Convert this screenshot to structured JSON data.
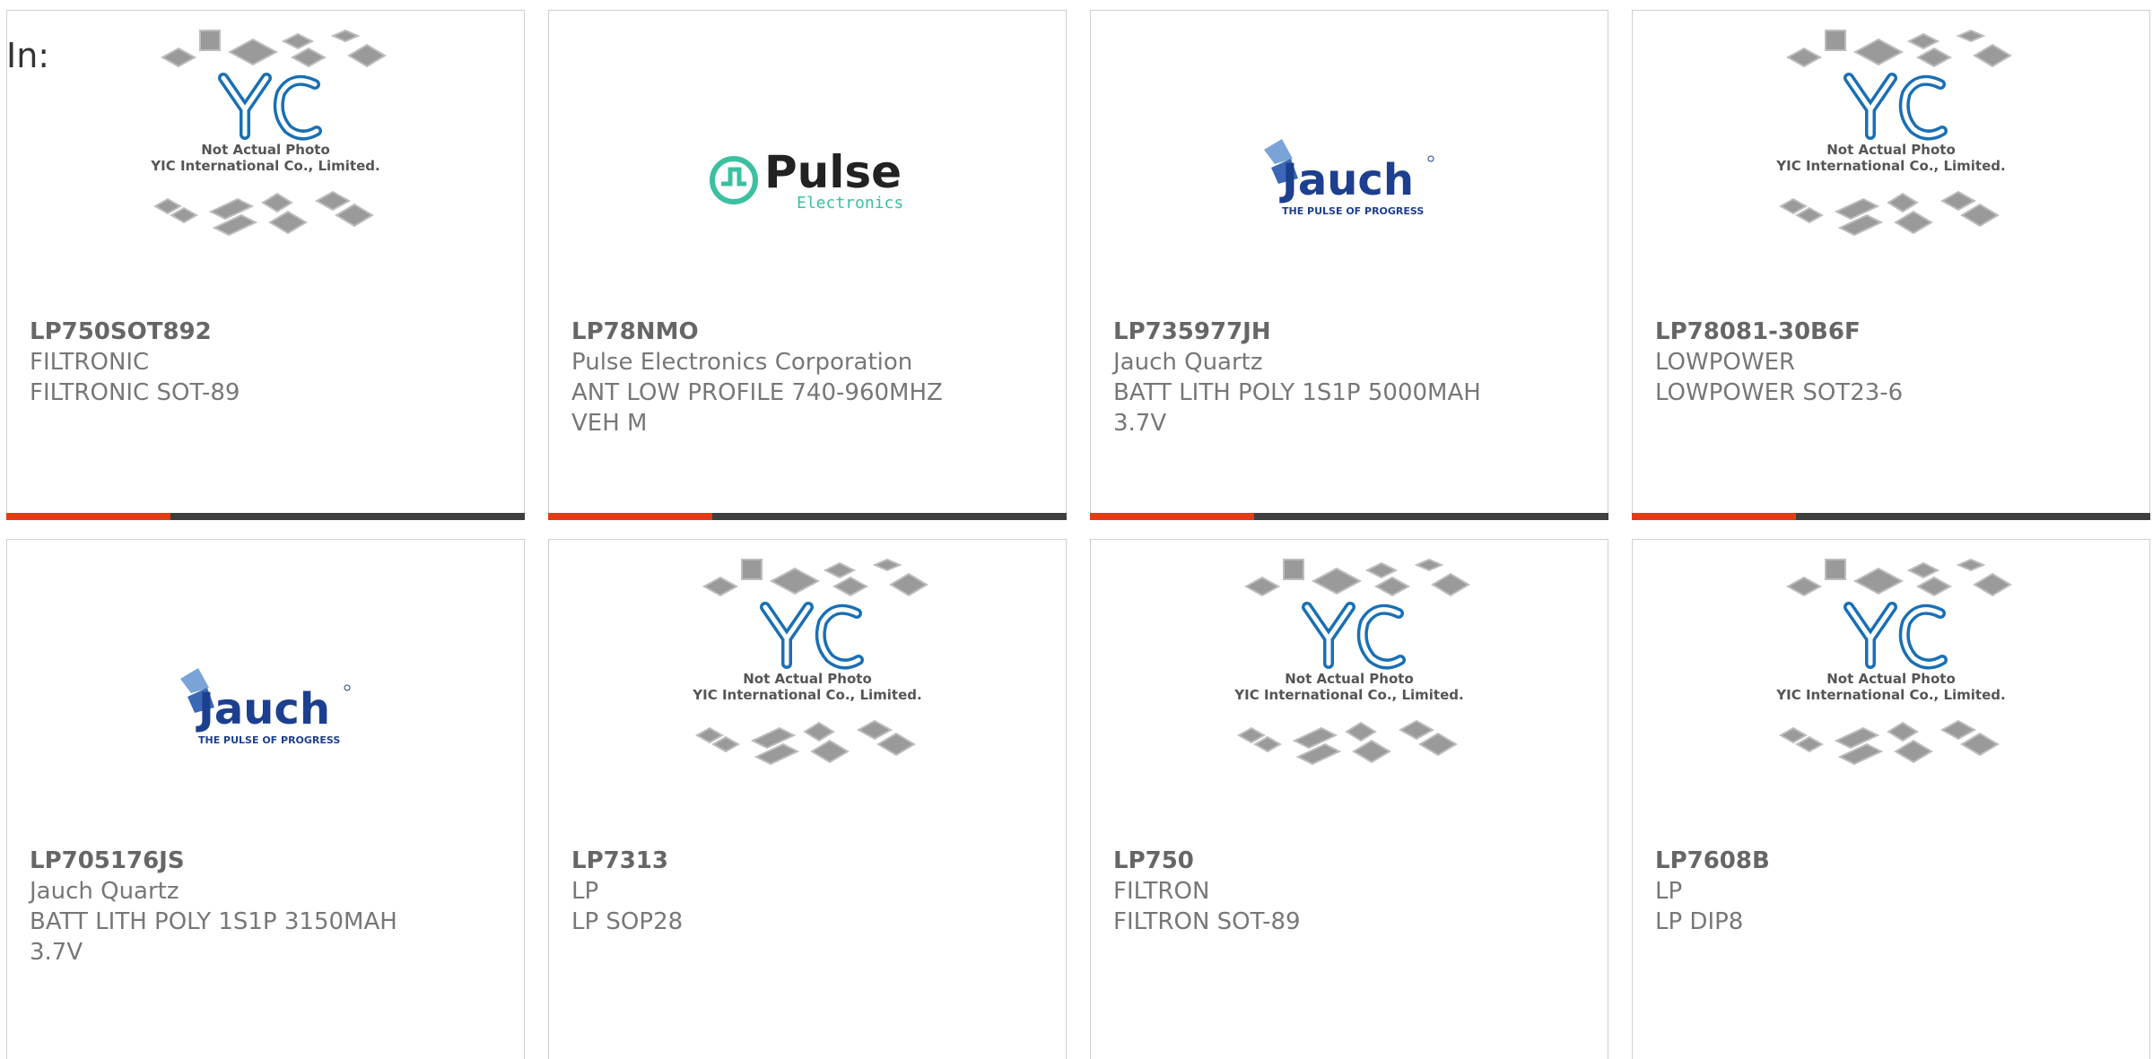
{
  "header": {
    "label": "In:"
  },
  "colors": {
    "accent": "#e23c16",
    "bar": "#3f3f3f",
    "text": "#666666",
    "yic_blue": "#1a6fb4",
    "pulse_green": "#3cc0a0",
    "jauch_blue": "#1d3f8f"
  },
  "placeholder": {
    "line1": "Not Actual Photo",
    "line2": "YIC International Co., Limited."
  },
  "logos": {
    "pulse": {
      "name": "Pulse",
      "sub": "Electronics"
    },
    "jauch": {
      "name": "Jauch",
      "sub": "THE PULSE OF PROGRESS"
    }
  },
  "products": [
    {
      "part": "LP750SOT892",
      "maker": "FILTRONIC",
      "desc": "FILTRONIC SOT-89",
      "desc2": "",
      "image": "yic-placeholder"
    },
    {
      "part": "LP78NMO",
      "maker": "Pulse Electronics Corporation",
      "desc": "ANT LOW PROFILE 740-960MHZ",
      "desc2": "VEH M",
      "image": "pulse-logo"
    },
    {
      "part": "LP735977JH",
      "maker": "Jauch Quartz",
      "desc": "BATT LITH POLY 1S1P 5000MAH",
      "desc2": "3.7V",
      "image": "jauch-logo"
    },
    {
      "part": "LP78081-30B6F",
      "maker": "LOWPOWER",
      "desc": "LOWPOWER SOT23-6",
      "desc2": "",
      "image": "yic-placeholder"
    },
    {
      "part": "LP705176JS",
      "maker": "Jauch Quartz",
      "desc": "BATT LITH POLY 1S1P 3150MAH",
      "desc2": "3.7V",
      "image": "jauch-logo"
    },
    {
      "part": "LP7313",
      "maker": "LP",
      "desc": "LP SOP28",
      "desc2": "",
      "image": "yic-placeholder"
    },
    {
      "part": "LP750",
      "maker": "FILTRON",
      "desc": "FILTRON SOT-89",
      "desc2": "",
      "image": "yic-placeholder"
    },
    {
      "part": "LP7608B",
      "maker": "LP",
      "desc": "LP DIP8",
      "desc2": "",
      "image": "yic-placeholder"
    }
  ]
}
